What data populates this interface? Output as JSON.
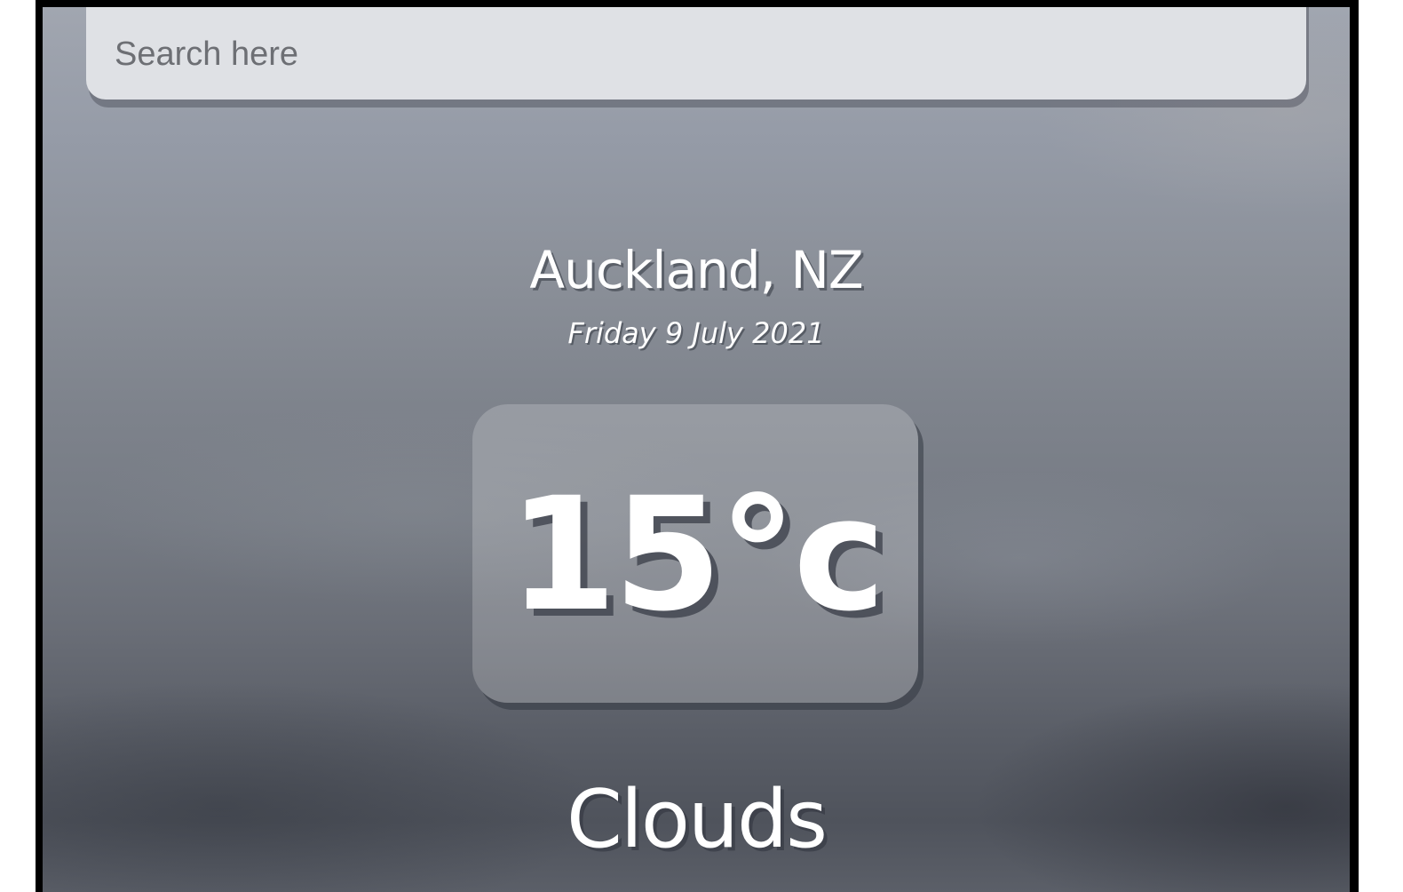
{
  "search": {
    "placeholder": "Search here",
    "value": ""
  },
  "location": {
    "name": "Auckland, NZ",
    "date": "Friday 9 July 2021"
  },
  "weather": {
    "temperature": "15°c",
    "condition": "Clouds"
  },
  "colors": {
    "search_bg": "#dfe1e5",
    "text": "#ffffff",
    "sky_top": "#a1a6b0",
    "sky_bottom": "#4f535c"
  }
}
